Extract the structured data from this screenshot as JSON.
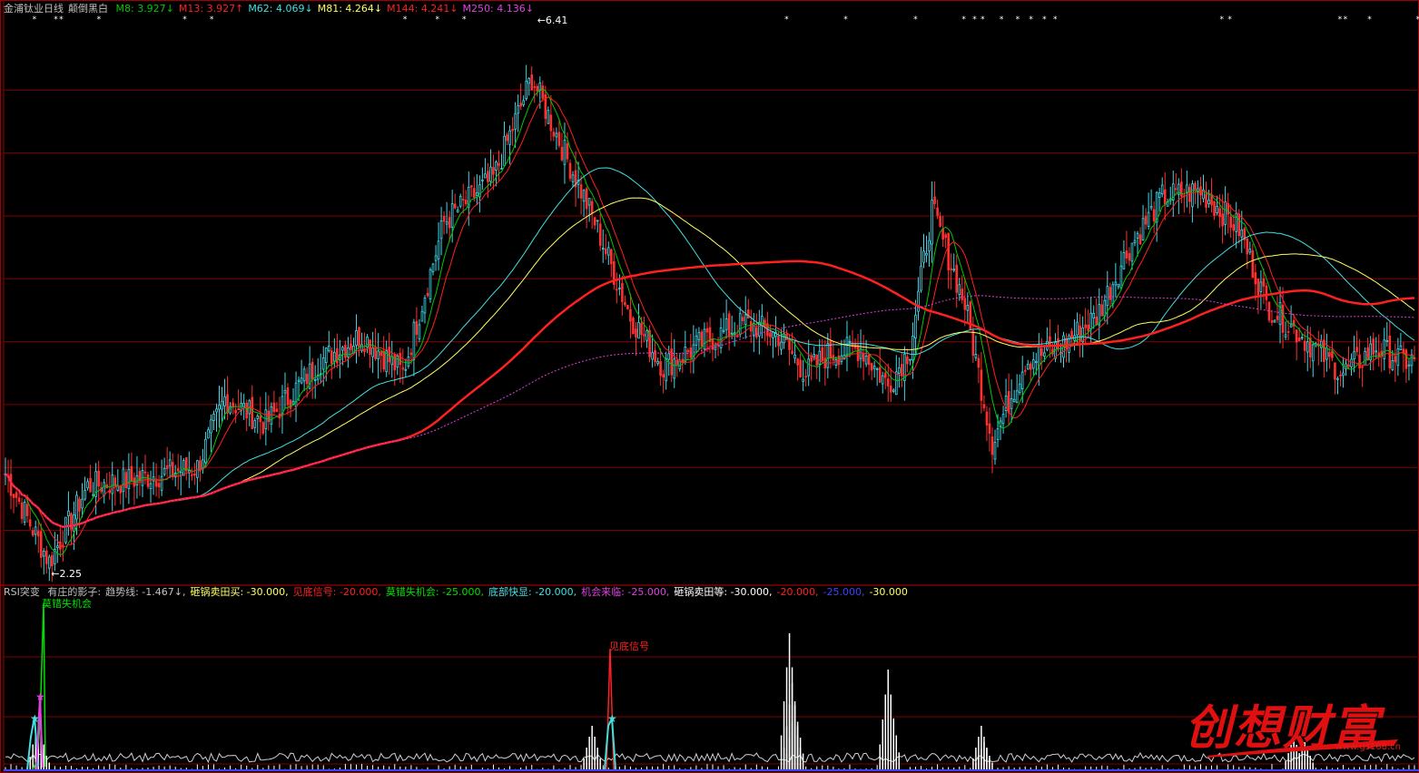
{
  "header": {
    "stock": "金浦钛业",
    "period": "日线",
    "mode": "颠倒黑白",
    "ma": [
      {
        "label": "M8:",
        "value": "3.927",
        "arrow": "↓",
        "color": "#00c800"
      },
      {
        "label": "M13:",
        "value": "3.927",
        "arrow": "↑",
        "color": "#ff2020"
      },
      {
        "label": "M62:",
        "value": "4.069",
        "arrow": "↓",
        "color": "#40e0e0"
      },
      {
        "label": "M81:",
        "value": "4.264",
        "arrow": "↓",
        "color": "#ffff60"
      },
      {
        "label": "M144:",
        "value": "4.241",
        "arrow": "↓",
        "color": "#ff2020"
      },
      {
        "label": "M250:",
        "value": "4.136",
        "arrow": "↓",
        "color": "#e040e0"
      }
    ]
  },
  "indicator_header": {
    "name": "RSI突变",
    "items": [
      {
        "text": "有庄的影子:",
        "color": "#c0c0c0"
      },
      {
        "text": "趋势线: -1.467↓,",
        "color": "#c0c0c0"
      },
      {
        "text": "砸锅卖田买: -30.000,",
        "color": "#ffff60"
      },
      {
        "text": "见底信号: -20.000,",
        "color": "#ff2020"
      },
      {
        "text": "莫错失机会: -25.000,",
        "color": "#00e000"
      },
      {
        "text": "底部快显: -20.000,",
        "color": "#40e0e0"
      },
      {
        "text": "机会来临: -25.000,",
        "color": "#e040e0"
      },
      {
        "text": "砸锅卖田等: -30.000,",
        "color": "#ffffff"
      },
      {
        "text": "-20.000,",
        "color": "#ff2020"
      },
      {
        "text": "-25.000,",
        "color": "#4040ff"
      },
      {
        "text": "-30.000",
        "color": "#ffff60"
      }
    ]
  },
  "annotations": {
    "high": "6.41",
    "low": "2.25",
    "signal_green": "莫错失机会",
    "signal_red": "见底信号"
  },
  "watermark": {
    "text": "创想财富",
    "url": "www.gs168.cn"
  },
  "colors": {
    "up": "#40d8e8",
    "down": "#ff3030",
    "grid": "#800000"
  },
  "chart_data": {
    "type": "candlestick",
    "ylim": [
      2.1,
      6.5
    ],
    "price_ticks": [
      2.5,
      3.0,
      3.5,
      4.0,
      4.5,
      5.0,
      5.5,
      6.0
    ],
    "anchors": [
      [
        0,
        2.95
      ],
      [
        12,
        2.42
      ],
      [
        16,
        2.25
      ],
      [
        30,
        2.85
      ],
      [
        45,
        2.9
      ],
      [
        70,
        3.0
      ],
      [
        80,
        3.55
      ],
      [
        95,
        3.35
      ],
      [
        115,
        3.85
      ],
      [
        130,
        4.05
      ],
      [
        145,
        3.75
      ],
      [
        160,
        4.95
      ],
      [
        178,
        5.3
      ],
      [
        192,
        6.1
      ],
      [
        203,
        5.55
      ],
      [
        215,
        4.95
      ],
      [
        228,
        4.2
      ],
      [
        240,
        3.8
      ],
      [
        255,
        4.0
      ],
      [
        270,
        4.15
      ],
      [
        282,
        4.05
      ],
      [
        292,
        3.75
      ],
      [
        300,
        3.9
      ],
      [
        312,
        3.95
      ],
      [
        322,
        3.65
      ],
      [
        330,
        3.95
      ],
      [
        338,
        5.05
      ],
      [
        350,
        4.3
      ],
      [
        360,
        3.2
      ],
      [
        372,
        3.85
      ],
      [
        384,
        3.95
      ],
      [
        398,
        4.2
      ],
      [
        410,
        4.75
      ],
      [
        422,
        5.15
      ],
      [
        436,
        5.2
      ],
      [
        450,
        4.9
      ],
      [
        460,
        4.3
      ],
      [
        475,
        4.0
      ],
      [
        488,
        3.75
      ],
      [
        500,
        3.95
      ],
      [
        510,
        3.85
      ]
    ],
    "high_low": {
      "high": 6.41,
      "low": 2.25
    },
    "indicator_spikes": [
      {
        "x": 12,
        "h": 55
      },
      {
        "x": 13,
        "h": 30
      },
      {
        "x": 214,
        "h": 48
      },
      {
        "x": 286,
        "h": 150
      },
      {
        "x": 287,
        "h": 95
      },
      {
        "x": 288,
        "h": 70
      },
      {
        "x": 322,
        "h": 110
      },
      {
        "x": 323,
        "h": 75
      },
      {
        "x": 356,
        "h": 48
      },
      {
        "x": 357,
        "h": 30
      },
      {
        "x": 470,
        "h": 36
      },
      {
        "x": 474,
        "h": 30
      }
    ]
  }
}
